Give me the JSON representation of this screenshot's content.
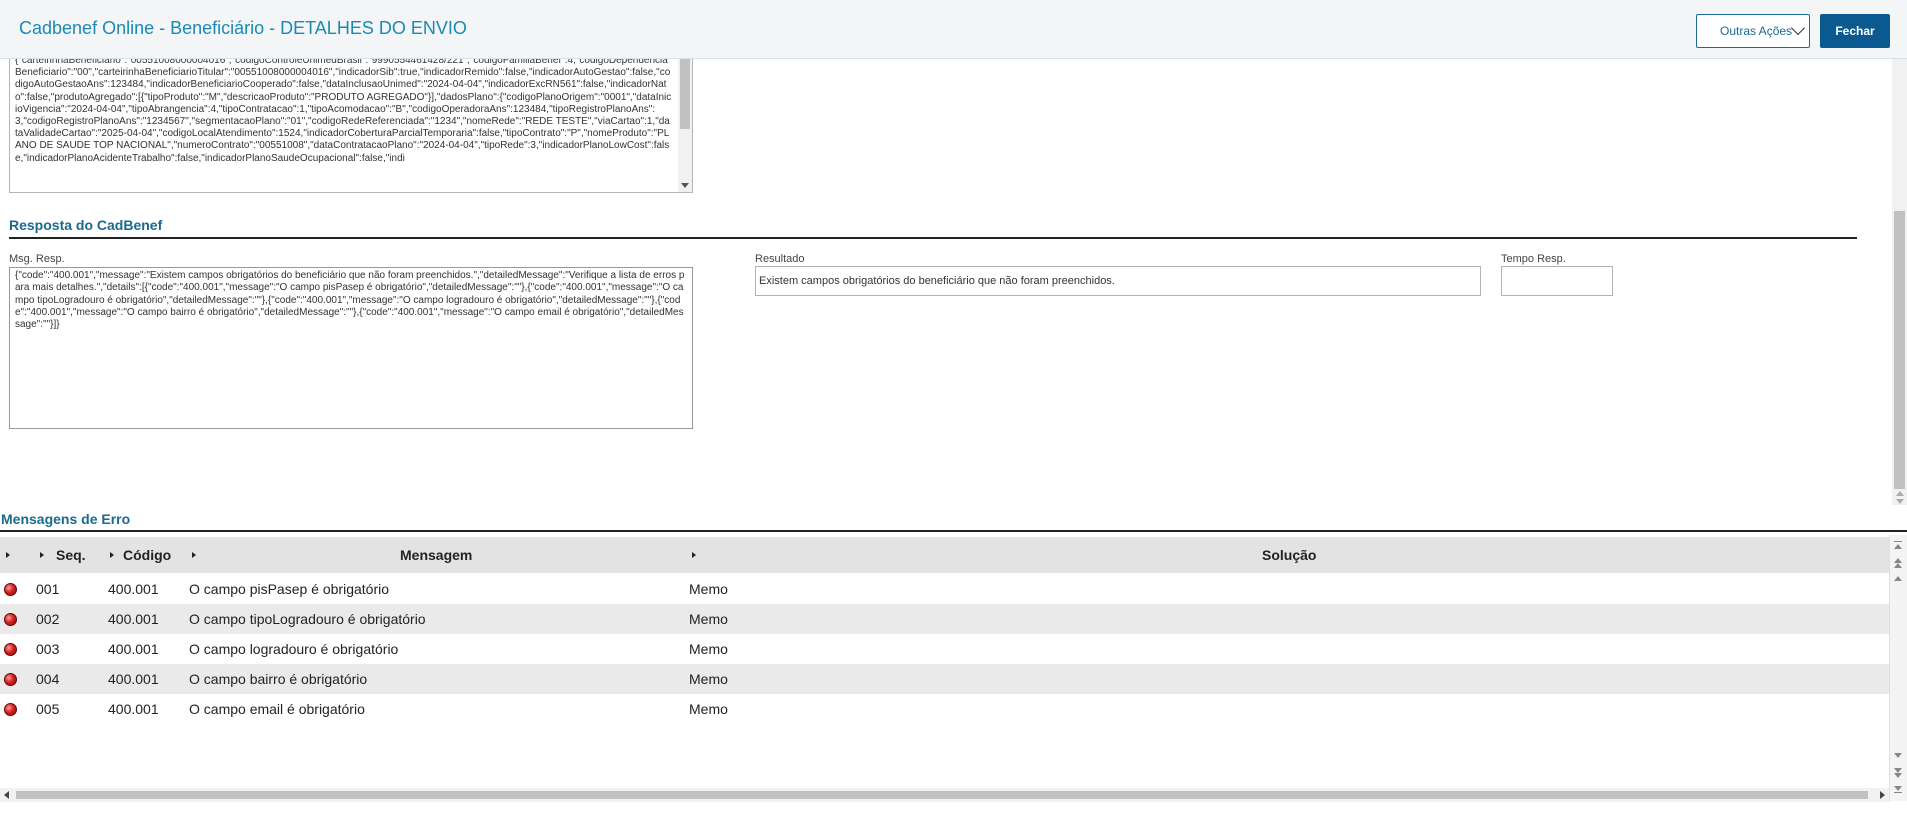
{
  "header": {
    "title": "Cadbenef Online - Beneficiário - DETALHES DO ENVIO",
    "outras_acoes_label": "Outras Ações",
    "fechar_label": "Fechar"
  },
  "request_text": "{\"carteirinhaBeneficiario\":\"00551008000004016\",\"codigoControleUnimedBrasil\":\"9990554461428/221\",\"codigoFamiliaBenef\":4,\"codigoDependenciaBeneficiario\":\"00\",\"carteirinhaBeneficiarioTitular\":\"00551008000004016\",\"indicadorSib\":true,\"indicadorRemido\":false,\"indicadorAutoGestao\":false,\"codigoAutoGestaoAns\":123484,\"indicadorBeneficiarioCooperado\":false,\"dataInclusaoUnimed\":\"2024-04-04\",\"indicadorExcRN561\":false,\"indicadorNato\":false,\"produtoAgregado\":[{\"tipoProduto\":\"M\",\"descricaoProduto\":\"PRODUTO AGREGADO\"}],\"dadosPlano\":{\"codigoPlanoOrigem\":\"0001\",\"dataInicioVigencia\":\"2024-04-04\",\"tipoAbrangencia\":4,\"tipoContratacao\":1,\"tipoAcomodacao\":\"B\",\"codigoOperadoraAns\":123484,\"tipoRegistroPlanoAns\":3,\"codigoRegistroPlanoAns\":\"1234567\",\"segmentacaoPlano\":\"01\",\"codigoRedeReferenciada\":\"1234\",\"nomeRede\":\"REDE TESTE\",\"viaCartao\":1,\"dataValidadeCartao\":\"2025-04-04\",\"codigoLocalAtendimento\":1524,\"indicadorCoberturaParcialTemporaria\":false,\"tipoContrato\":\"P\",\"nomeProduto\":\"PLANO DE SAUDE TOP NACIONAL\",\"numeroContrato\":\"00551008\",\"dataContratacaoPlano\":\"2024-04-04\",\"tipoRede\":3,\"indicadorPlanoLowCost\":false,\"indicadorPlanoAcidenteTrabalho\":false,\"indicadorPlanoSaudeOcupacional\":false,\"indi",
  "resposta": {
    "section_title": "Resposta do CadBenef",
    "msg_label": "Msg. Resp.",
    "msg_value": "{\"code\":\"400.001\",\"message\":\"Existem campos obrigatórios do beneficiário que não foram preenchidos.\",\"detailedMessage\":\"Verifique a lista de erros para mais detalhes.\",\"details\":[{\"code\":\"400.001\",\"message\":\"O campo pisPasep é obrigatório\",\"detailedMessage\":\"\"},{\"code\":\"400.001\",\"message\":\"O campo tipoLogradouro é obrigatório\",\"detailedMessage\":\"\"},{\"code\":\"400.001\",\"message\":\"O campo logradouro é obrigatório\",\"detailedMessage\":\"\"},{\"code\":\"400.001\",\"message\":\"O campo bairro é obrigatório\",\"detailedMessage\":\"\"},{\"code\":\"400.001\",\"message\":\"O campo email é obrigatório\",\"detailedMessage\":\"\"}]}",
    "resultado_label": "Resultado",
    "resultado_value": "Existem campos obrigatórios do beneficiário que não foram preenchidos.",
    "tempo_label": "Tempo Resp.",
    "tempo_value": ""
  },
  "erros": {
    "section_title": "Mensagens de Erro",
    "columns": {
      "seq": "Seq.",
      "codigo": "Código",
      "mensagem": "Mensagem",
      "solucao": "Solução"
    },
    "rows": [
      {
        "seq": "001",
        "codigo": "400.001",
        "mensagem": "O campo pisPasep é obrigatório",
        "solucao": "Memo"
      },
      {
        "seq": "002",
        "codigo": "400.001",
        "mensagem": "O campo tipoLogradouro é obrigatório",
        "solucao": "Memo"
      },
      {
        "seq": "003",
        "codigo": "400.001",
        "mensagem": "O campo logradouro é obrigatório",
        "solucao": "Memo"
      },
      {
        "seq": "004",
        "codigo": "400.001",
        "mensagem": "O campo bairro é obrigatório",
        "solucao": "Memo"
      },
      {
        "seq": "005",
        "codigo": "400.001",
        "mensagem": "O campo email é obrigatório",
        "solucao": "Memo"
      }
    ]
  },
  "colors": {
    "title": "#1a8ab5",
    "section": "#1a6a8f",
    "primary_button": "#0a5a91",
    "status_error": "#d42121"
  }
}
